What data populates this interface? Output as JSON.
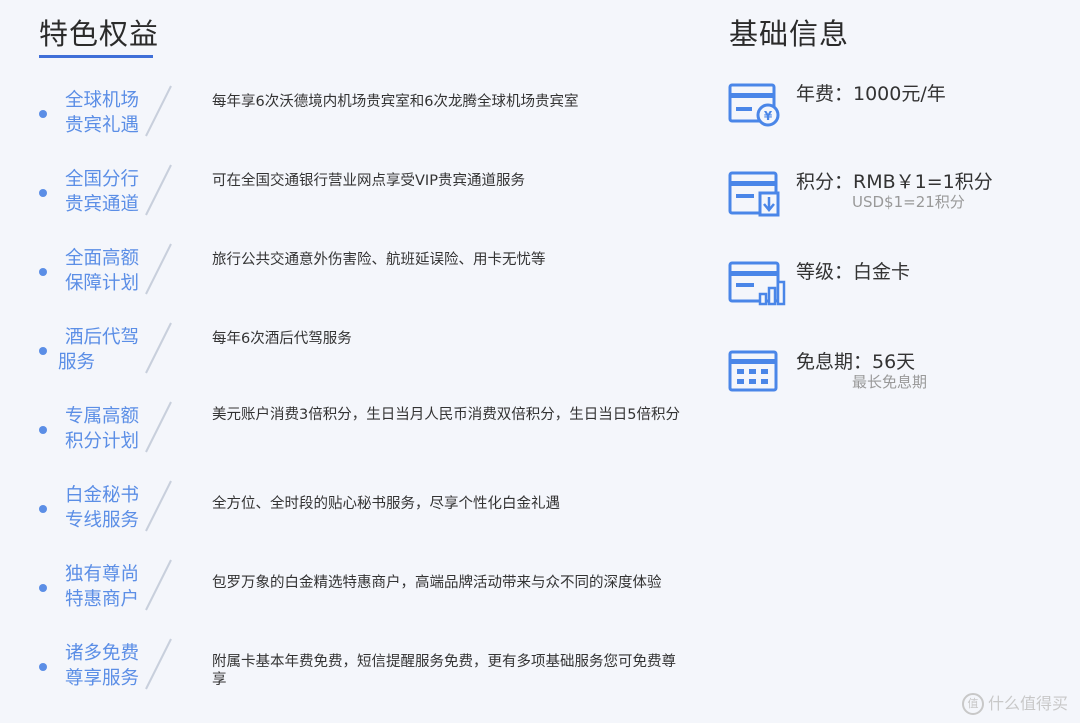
{
  "benefits_section": {
    "title": "特色权益",
    "items": [
      {
        "name_line1": "全球机场",
        "name_line2": "贵宾礼遇",
        "desc": "每年享6次沃德境内机场贵宾室和6次龙腾全球机场贵宾室"
      },
      {
        "name_line1": "全国分行",
        "name_line2": "贵宾通道",
        "desc": "可在全国交通银行营业网点享受VIP贵宾通道服务"
      },
      {
        "name_line1": "全面高额",
        "name_line2": "保障计划",
        "desc": "旅行公共交通意外伤害险、航班延误险、用卡无忧等"
      },
      {
        "name_line1": "酒后代驾",
        "name_line2": "服务",
        "desc": "每年6次酒后代驾服务"
      },
      {
        "name_line1": "专属高额",
        "name_line2": "积分计划",
        "desc": "美元账户消费3倍积分，生日当月人民币消费双倍积分，生日当日5倍积分"
      },
      {
        "name_line1": "白金秘书",
        "name_line2": "专线服务",
        "desc": "全方位、全时段的贴心秘书服务，尽享个性化白金礼遇"
      },
      {
        "name_line1": "独有尊尚",
        "name_line2": "特惠商户",
        "desc": "包罗万象的白金精选特惠商户，高端品牌活动带来与众不同的深度体验"
      },
      {
        "name_line1": "诸多免费",
        "name_line2": "尊享服务",
        "desc": "附属卡基本年费免费，短信提醒服务免费，更有多项基础服务您可免费尊享"
      }
    ]
  },
  "info_section": {
    "title": "基础信息",
    "annual_fee": "年费：1000元/年",
    "points": "积分：RMB￥1=1积分",
    "points_sub": "USD$1=21积分",
    "level": "等级：白金卡",
    "interest_free": "免息期：56天",
    "interest_free_sub": "最长免息期"
  },
  "watermark": {
    "text": "什么值得买",
    "icon_glyph": "值"
  },
  "colors": {
    "accent": "#5b8ee6",
    "underline": "#3f6fd8",
    "icon": "#4a86e8",
    "divider": "#c8cfdc"
  }
}
